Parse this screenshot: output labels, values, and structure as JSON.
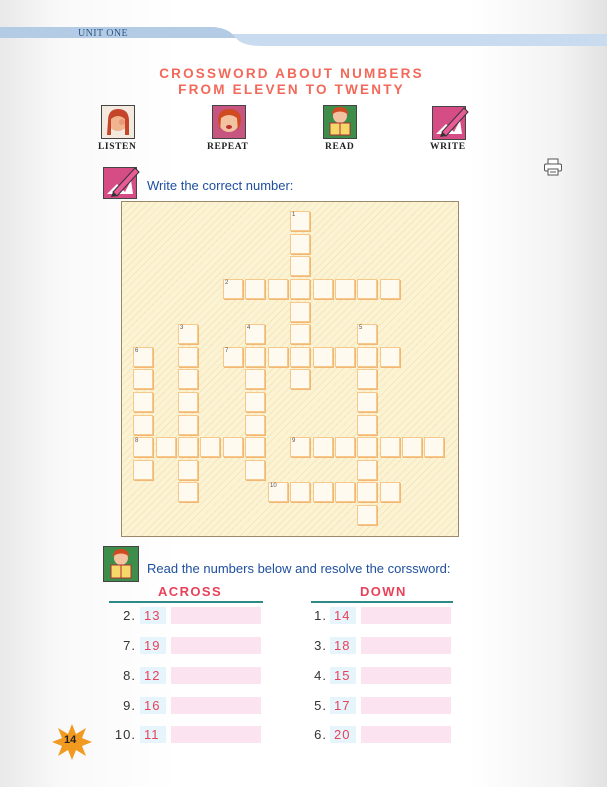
{
  "header": {
    "unit": "UNIT ONE"
  },
  "title": {
    "line1": "CROSSWORD ABOUT NUMBERS",
    "line2": "FROM ELEVEN TO TWENTY"
  },
  "activities": [
    {
      "label": "LISTEN",
      "icon": "listening-girl-icon"
    },
    {
      "label": "REPEAT",
      "icon": "speaking-girl-icon"
    },
    {
      "label": "READ",
      "icon": "reading-girl-icon"
    },
    {
      "label": "WRITE",
      "icon": "pencil-writing-icon"
    }
  ],
  "exercise1": {
    "instruction": "Write the correct number:"
  },
  "crossword": {
    "numbers": [
      "1",
      "2",
      "3",
      "4",
      "5",
      "6",
      "7",
      "8",
      "9",
      "10"
    ]
  },
  "exercise2": {
    "instruction": "Read the numbers below and resolve the corssword:",
    "across_label": "ACROSS",
    "down_label": "DOWN",
    "across": [
      {
        "num": "2.",
        "value": "13"
      },
      {
        "num": "7.",
        "value": "19"
      },
      {
        "num": "8.",
        "value": "12"
      },
      {
        "num": "9.",
        "value": "16"
      },
      {
        "num": "10.",
        "value": "11"
      }
    ],
    "down": [
      {
        "num": "1.",
        "value": "14"
      },
      {
        "num": "3.",
        "value": "18"
      },
      {
        "num": "4.",
        "value": "15"
      },
      {
        "num": "5.",
        "value": "17"
      },
      {
        "num": "6.",
        "value": "20"
      }
    ]
  },
  "page": {
    "number": "14"
  },
  "colors": {
    "title": "#f2685a",
    "instruction": "#1d4f9f",
    "accent_red": "#e8425a",
    "rule": "#2d8a86",
    "header_blue": "#bcd3ea"
  }
}
